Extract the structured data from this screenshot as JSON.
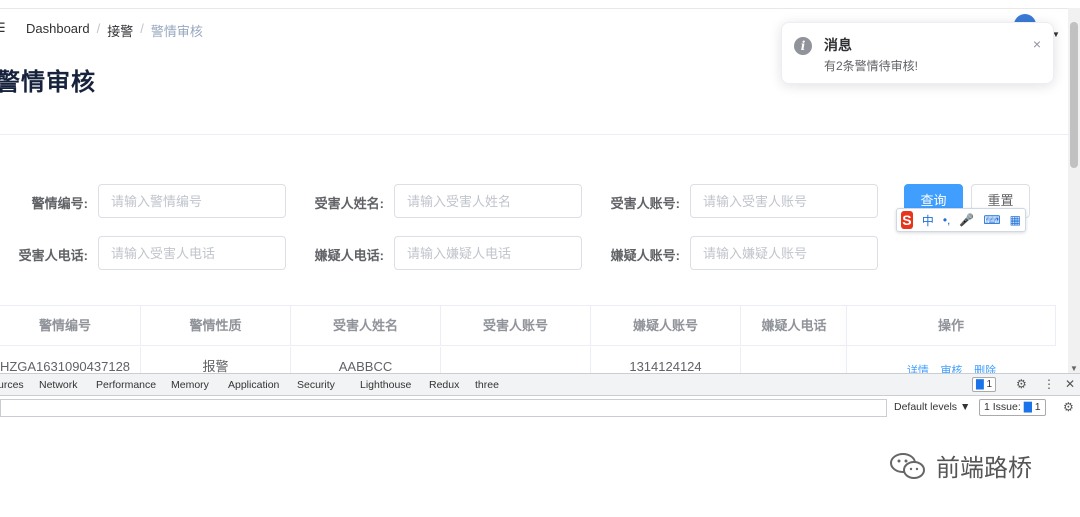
{
  "header": {
    "hamburger_glyph": "☰",
    "breadcrumb": [
      "Dashboard",
      "接警",
      "警情审核"
    ],
    "breadcrumb_sep": "/",
    "title": "警情审核"
  },
  "notification": {
    "title": "消息",
    "message": "有2条警情待审核!",
    "close": "×",
    "icon": "info-icon"
  },
  "search_form": {
    "fields": [
      {
        "label": "警情编号:",
        "placeholder": "请输入警情编号"
      },
      {
        "label": "受害人姓名:",
        "placeholder": "请输入受害人姓名"
      },
      {
        "label": "受害人账号:",
        "placeholder": "请输入受害人账号"
      },
      {
        "label": "受害人电话:",
        "placeholder": "请输入受害人电话"
      },
      {
        "label": "嫌疑人电话:",
        "placeholder": "请输入嫌疑人电话"
      },
      {
        "label": "嫌疑人账号:",
        "placeholder": "请输入嫌疑人账号"
      }
    ],
    "query_button": "查询",
    "reset_button": "重置"
  },
  "ime_toolbar": {
    "logo": "S",
    "mode": "中",
    "punct": "•,",
    "mic": "🎤",
    "keyboard": "⌨",
    "menu": "▦"
  },
  "table": {
    "headers": [
      "警情编号",
      "警情性质",
      "受害人姓名",
      "受害人账号",
      "嫌疑人账号",
      "嫌疑人电话",
      "操作"
    ],
    "rows": [
      {
        "id": "HZGA1631090437128",
        "nature": "报警",
        "victim_name": "AABBCC",
        "victim_account": "",
        "suspect_account": "1314124124",
        "suspect_phone": "",
        "actions": [
          "详情",
          "审核",
          "删除"
        ]
      }
    ]
  },
  "devtools": {
    "tabs": [
      "urces",
      "Network",
      "Performance",
      "Memory",
      "Application",
      "Security",
      "Lighthouse",
      "Redux",
      "three"
    ],
    "badge_count": "1",
    "default_levels": "Default levels ▼",
    "issues_label": "1 Issue:",
    "issues_count": "1"
  },
  "watermark": {
    "text": "前端路桥"
  },
  "colors": {
    "primary": "#409eff",
    "notify_icon": "#909399",
    "ime_logo": "#e8341c"
  }
}
